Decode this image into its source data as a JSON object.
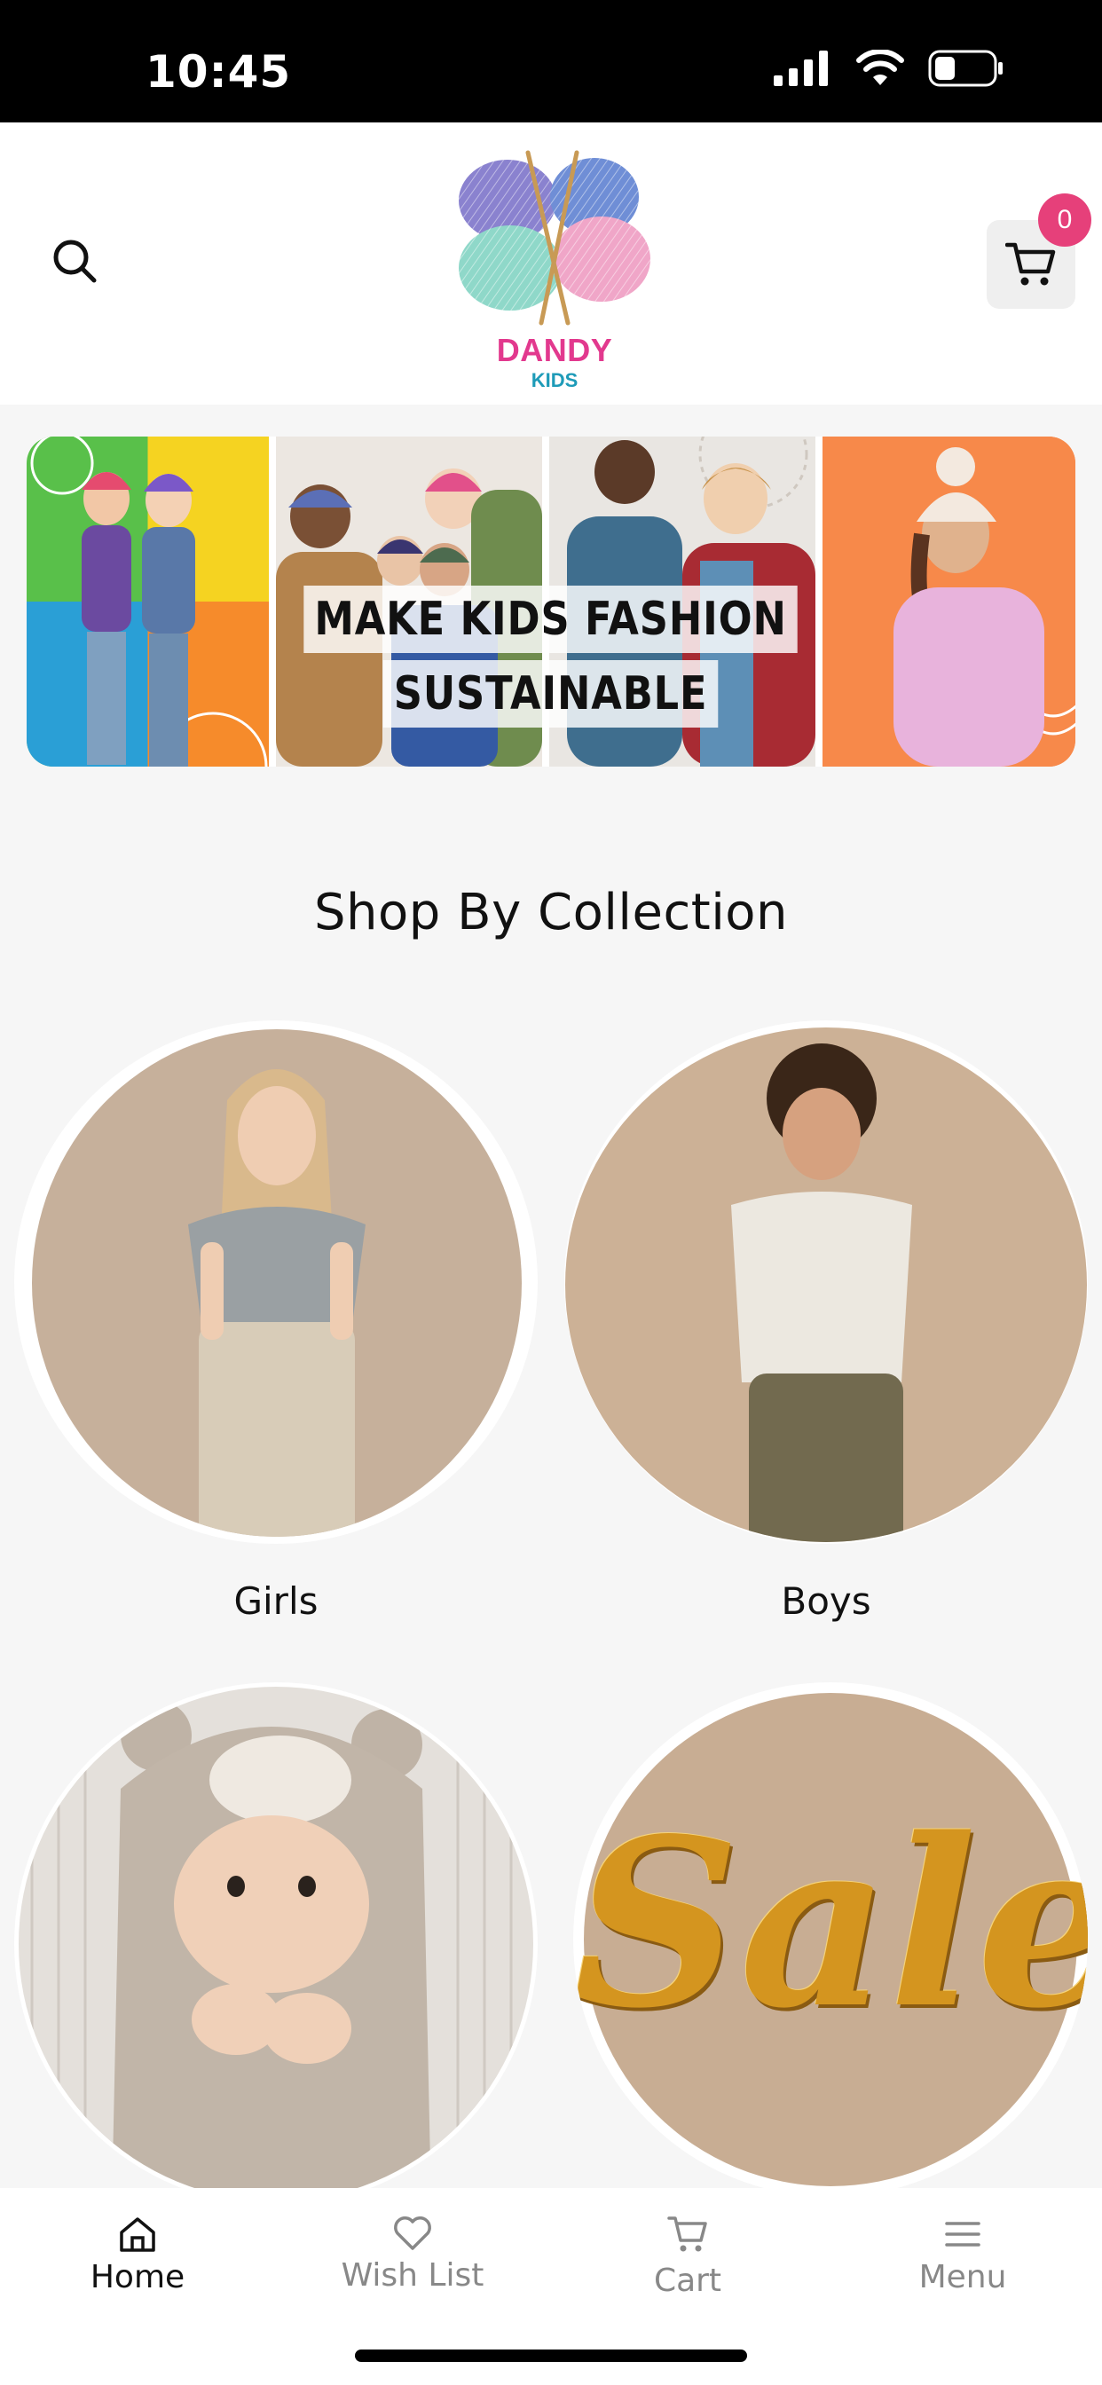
{
  "status_bar": {
    "time": "10:45"
  },
  "header": {
    "logo_brand": "DANDY",
    "logo_sub": "KIDS",
    "cart_count": "0"
  },
  "banner": {
    "headline_line1": "MAKE KIDS FASHION",
    "headline_line2": "SUSTAINABLE"
  },
  "section": {
    "title": "Shop By Collection"
  },
  "collections": [
    {
      "label": "Girls"
    },
    {
      "label": "Boys"
    },
    {
      "label": ""
    },
    {
      "label": ""
    }
  ],
  "sale_image_text": "Sale",
  "bottom_nav": {
    "items": [
      {
        "label": "Home",
        "icon": "home-icon",
        "active": true
      },
      {
        "label": "Wish List",
        "icon": "heart-icon",
        "active": false
      },
      {
        "label": "Cart",
        "icon": "cart-icon",
        "active": false
      },
      {
        "label": "Menu",
        "icon": "menu-icon",
        "active": false
      }
    ]
  },
  "colors": {
    "accent_pink": "#e6407a",
    "logo_pink": "#e2398e",
    "logo_teal": "#1e9bb8",
    "tile_beige": "#c8ad93"
  }
}
